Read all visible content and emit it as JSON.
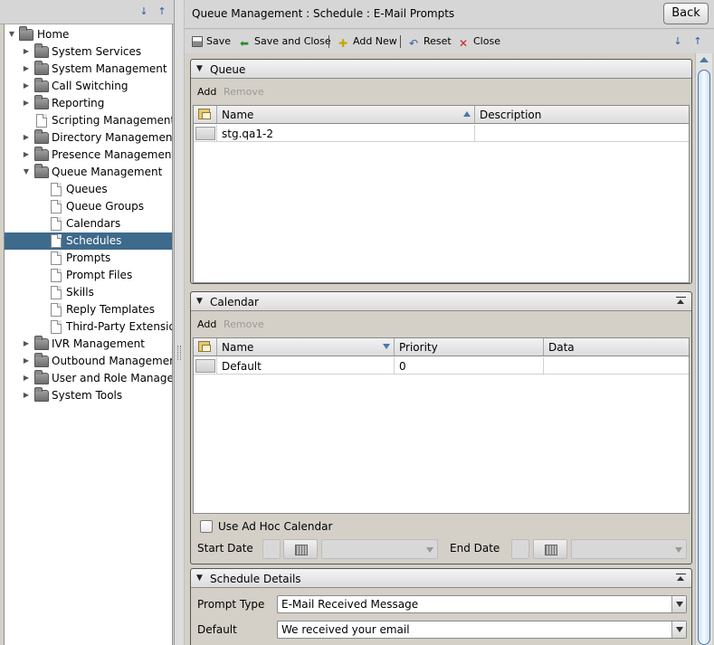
{
  "app": {
    "page_title": "Queue Management : Schedule : E-Mail Prompts"
  },
  "header": {
    "back_label": "Back"
  },
  "toolbar": {
    "save": "Save",
    "save_and_close": "Save and Close",
    "add_new": "Add New",
    "reset": "Reset",
    "close": "Close",
    "separator": "|"
  },
  "tree": {
    "root": "Home",
    "items": [
      "System Services",
      "System Management",
      "Call Switching",
      "Reporting",
      "Scripting Management",
      "Directory Management",
      "Presence Management",
      "Queue Management",
      "Queues",
      "Queue Groups",
      "Calendars",
      "Schedules",
      "Prompts",
      "Prompt Files",
      "Skills",
      "Reply Templates",
      "Third-Party Extension",
      "IVR Management",
      "Outbound Management",
      "User and Role Managen",
      "System Tools"
    ],
    "selected": "Schedules"
  },
  "queue_section": {
    "title": "Queue",
    "add": "Add",
    "remove": "Remove",
    "columns": [
      "Name",
      "Description"
    ],
    "rows": [
      {
        "name": "stg.qa1-2",
        "description": ""
      }
    ]
  },
  "calendar_section": {
    "title": "Calendar",
    "add": "Add",
    "remove": "Remove",
    "columns": [
      "Name",
      "Priority",
      "Data"
    ],
    "rows": [
      {
        "name": "Default",
        "priority": "0",
        "data": ""
      }
    ],
    "adhoc_label": "Use Ad Hoc Calendar",
    "start_date_label": "Start Date",
    "end_date_label": "End Date"
  },
  "schedule_details": {
    "title": "Schedule Details",
    "prompt_type_label": "Prompt Type",
    "prompt_type_value": "E-Mail Received Message",
    "default_label": "Default",
    "default_value": "We received your email"
  },
  "colors": {
    "selection": "#3e6a8b",
    "accent": "#4a78a8"
  }
}
